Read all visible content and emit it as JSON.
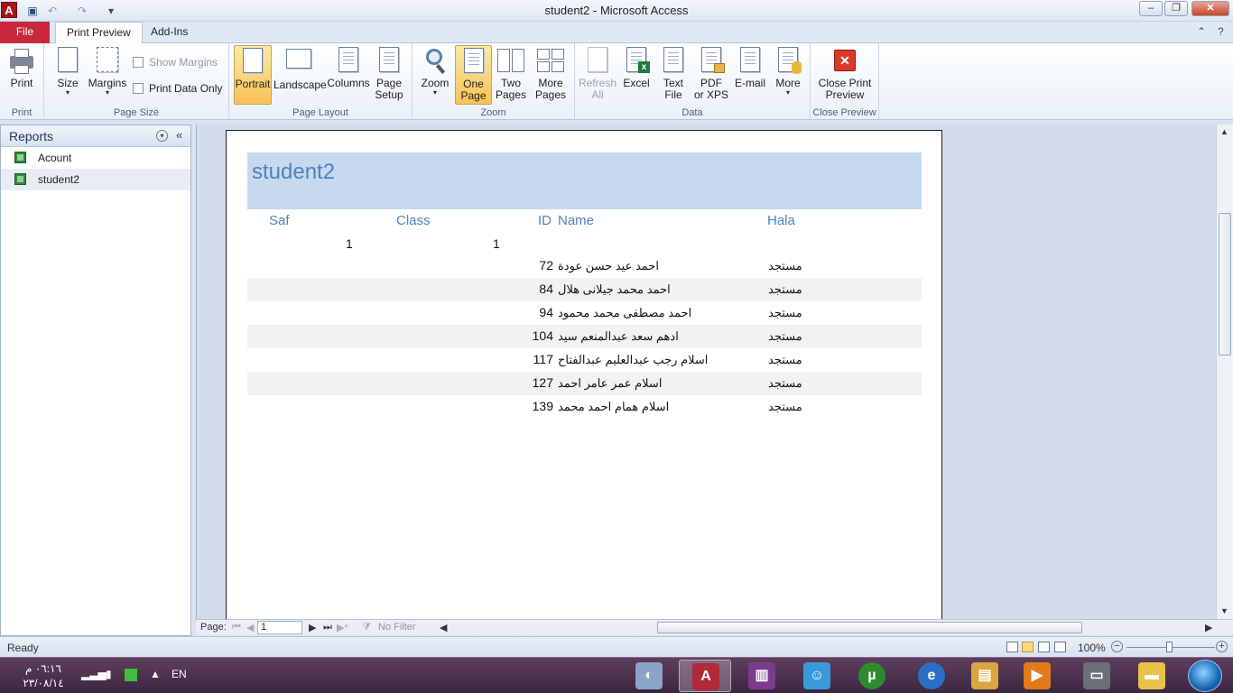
{
  "window": {
    "title": "student2 - Microsoft Access",
    "app_icon_letter": "A"
  },
  "tabs": {
    "file": "File",
    "print_preview": "Print Preview",
    "add_ins": "Add-Ins"
  },
  "ribbon": {
    "groups": {
      "print": "Print",
      "page_size": "Page Size",
      "page_layout": "Page Layout",
      "zoom": "Zoom",
      "data": "Data",
      "close_preview": "Close Preview"
    },
    "buttons": {
      "print": "Print",
      "size": "Size",
      "margins": "Margins",
      "show_margins": "Show Margins",
      "print_data_only": "Print Data Only",
      "portrait": "Portrait",
      "landscape": "Landscape",
      "columns": "Columns",
      "page_setup": "Page\nSetup",
      "zoom": "Zoom",
      "one_page": "One\nPage",
      "two_pages": "Two\nPages",
      "more_pages": "More\nPages",
      "refresh_all": "Refresh\nAll",
      "excel": "Excel",
      "text_file": "Text\nFile",
      "pdf_xps": "PDF\nor XPS",
      "email": "E-mail",
      "more": "More",
      "close_print_preview": "Close Print\nPreview"
    }
  },
  "nav": {
    "title": "Reports",
    "items": [
      {
        "label": "Acount"
      },
      {
        "label": "student2"
      }
    ]
  },
  "report": {
    "title": "student2",
    "columns": {
      "saf": "Saf",
      "class": "Class",
      "id": "ID",
      "name": "Name",
      "hala": "Hala"
    },
    "group": {
      "saf": "1",
      "class": "1"
    },
    "rows": [
      {
        "id": "72",
        "name": "احمد عيد حسن عودة",
        "hala": "مستجد"
      },
      {
        "id": "84",
        "name": "احمد محمد جيلانى هلال",
        "hala": "مستجد"
      },
      {
        "id": "94",
        "name": "احمد مصطفى محمد محمود",
        "hala": "مستجد"
      },
      {
        "id": "104",
        "name": "ادهم سعد عبدالمنعم سيد",
        "hala": "مستجد"
      },
      {
        "id": "117",
        "name": "اسلام رجب عبدالعليم عبدالفتاح",
        "hala": "مستجد"
      },
      {
        "id": "127",
        "name": "اسلام عمر عامر احمد",
        "hala": "مستجد"
      },
      {
        "id": "139",
        "name": "اسلام همام احمد محمد",
        "hala": "مستجد"
      }
    ]
  },
  "pagebar": {
    "page_label": "Page:",
    "page_value": "1",
    "filter_label": "No Filter"
  },
  "status": {
    "text": "Ready",
    "zoom": "100%"
  },
  "taskbar": {
    "time": "٠٦:١٦ م",
    "date": "٢٣/٠٨/١٤",
    "language": "EN"
  },
  "colors": {
    "accent": "#4f81bd",
    "report_header_bg": "#c6d9ef",
    "file_tab": "#c8283c",
    "active_button": "#f8c254"
  }
}
